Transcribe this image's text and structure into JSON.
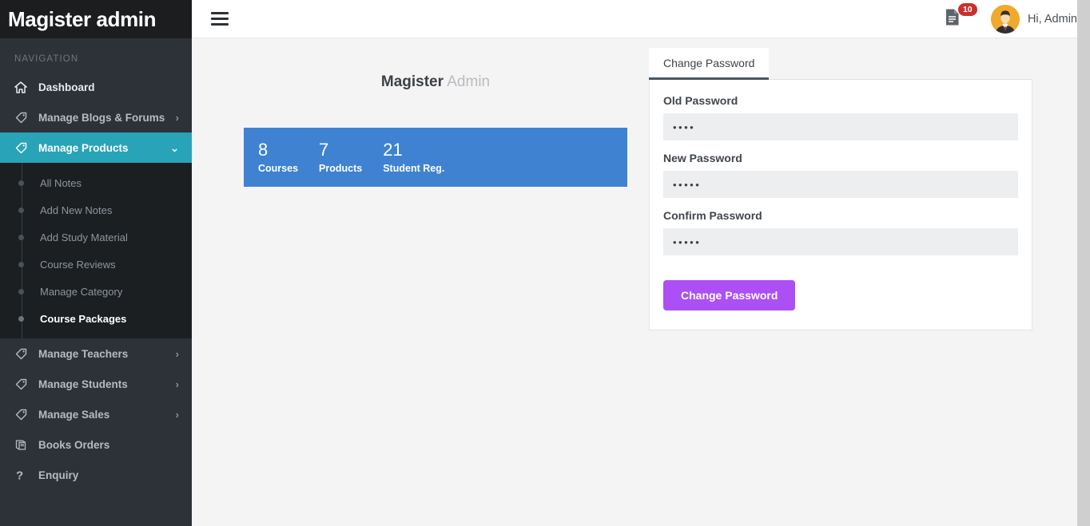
{
  "sidebar": {
    "brand": "Magister admin",
    "nav_label": "NAVIGATION",
    "items": [
      {
        "label": "Dashboard",
        "icon": "home-icon",
        "has_caret": false,
        "state": "plain"
      },
      {
        "label": "Manage Blogs & Forums",
        "icon": "tag-icon",
        "has_caret": true,
        "caret": "›",
        "state": "plain"
      },
      {
        "label": "Manage Products",
        "icon": "tag-icon",
        "has_caret": true,
        "caret": "⌄",
        "state": "active"
      },
      {
        "label": "Manage Teachers",
        "icon": "tag-icon",
        "has_caret": true,
        "caret": "›",
        "state": "plain"
      },
      {
        "label": "Manage Students",
        "icon": "tag-icon",
        "has_caret": true,
        "caret": "›",
        "state": "plain"
      },
      {
        "label": "Manage Sales",
        "icon": "tag-icon",
        "has_caret": true,
        "caret": "›",
        "state": "plain"
      },
      {
        "label": "Books Orders",
        "icon": "book-icon",
        "has_caret": false,
        "state": "plain"
      },
      {
        "label": "Enquiry",
        "icon": "question-icon",
        "has_caret": false,
        "state": "plain"
      }
    ],
    "submenu": [
      {
        "label": "All Notes",
        "current": false
      },
      {
        "label": "Add New Notes",
        "current": false
      },
      {
        "label": "Add Study Material",
        "current": false
      },
      {
        "label": "Course Reviews",
        "current": false
      },
      {
        "label": "Manage Category",
        "current": false
      },
      {
        "label": "Course Packages",
        "current": true
      }
    ]
  },
  "topbar": {
    "menu_icon": "hamburger-icon",
    "notification_icon": "document-icon",
    "notification_count": "10",
    "avatar_icon": "user-avatar",
    "greeting": "Hi, Admin"
  },
  "main": {
    "title_bold": "Magister",
    "title_light": "Admin",
    "stats": [
      {
        "value": "8",
        "label": "Courses"
      },
      {
        "value": "7",
        "label": "Products"
      },
      {
        "value": "21",
        "label": "Student Reg."
      }
    ]
  },
  "password_card": {
    "tab_label": "Change Password",
    "fields": [
      {
        "label": "Old Password",
        "value": "••••",
        "placeholder": "Old Password"
      },
      {
        "label": "New Password",
        "value": "•••••",
        "placeholder": "New Password"
      },
      {
        "label": "Confirm Password",
        "value": "•••••",
        "placeholder": "Confirm Password"
      }
    ],
    "submit_label": "Change Password"
  },
  "colors": {
    "sidebar_bg": "#2d3238",
    "sidebar_dark": "#1b1d1f",
    "submenu_bg": "#1b1f22",
    "accent_teal": "#29a3b8",
    "stats_blue": "#3f82d2",
    "button_purple": "#ac4ff5",
    "badge_red": "#c9302c",
    "avatar_orange": "#f0a92b",
    "tab_underline": "#4b5662"
  }
}
